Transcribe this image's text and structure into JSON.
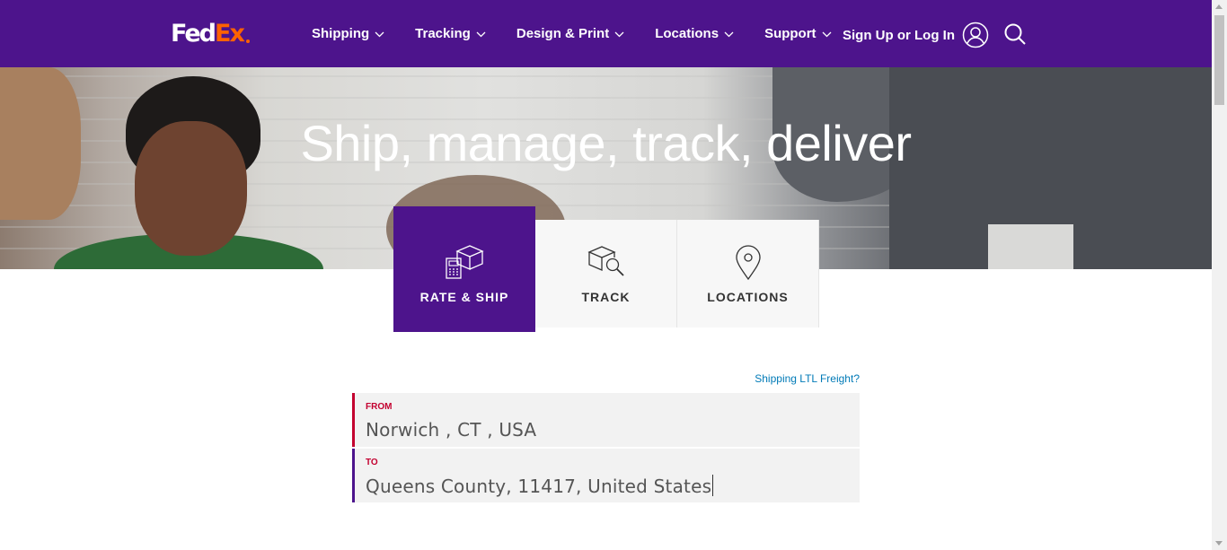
{
  "header": {
    "logo": {
      "fed": "Fed",
      "ex": "Ex"
    },
    "nav": [
      {
        "label": "Shipping"
      },
      {
        "label": "Tracking"
      },
      {
        "label": "Design & Print"
      },
      {
        "label": "Locations"
      },
      {
        "label": "Support"
      }
    ],
    "sign_in_label": "Sign Up or Log In"
  },
  "hero": {
    "title": "Ship, manage, track, deliver"
  },
  "tabs": [
    {
      "label": "RATE & SHIP",
      "icon": "rate-ship-icon",
      "active": true
    },
    {
      "label": "TRACK",
      "icon": "track-package-icon",
      "active": false
    },
    {
      "label": "LOCATIONS",
      "icon": "location-pin-icon",
      "active": false
    }
  ],
  "form": {
    "ltl_link": "Shipping LTL Freight?",
    "from": {
      "label": "FROM",
      "value": "Norwich , CT , USA"
    },
    "to": {
      "label": "TO",
      "value": "Queens County, 11417, United States"
    }
  },
  "colors": {
    "brand_purple": "#4d148c",
    "brand_orange": "#ff6200",
    "field_red": "#c3002f",
    "link_blue": "#007ab7"
  }
}
